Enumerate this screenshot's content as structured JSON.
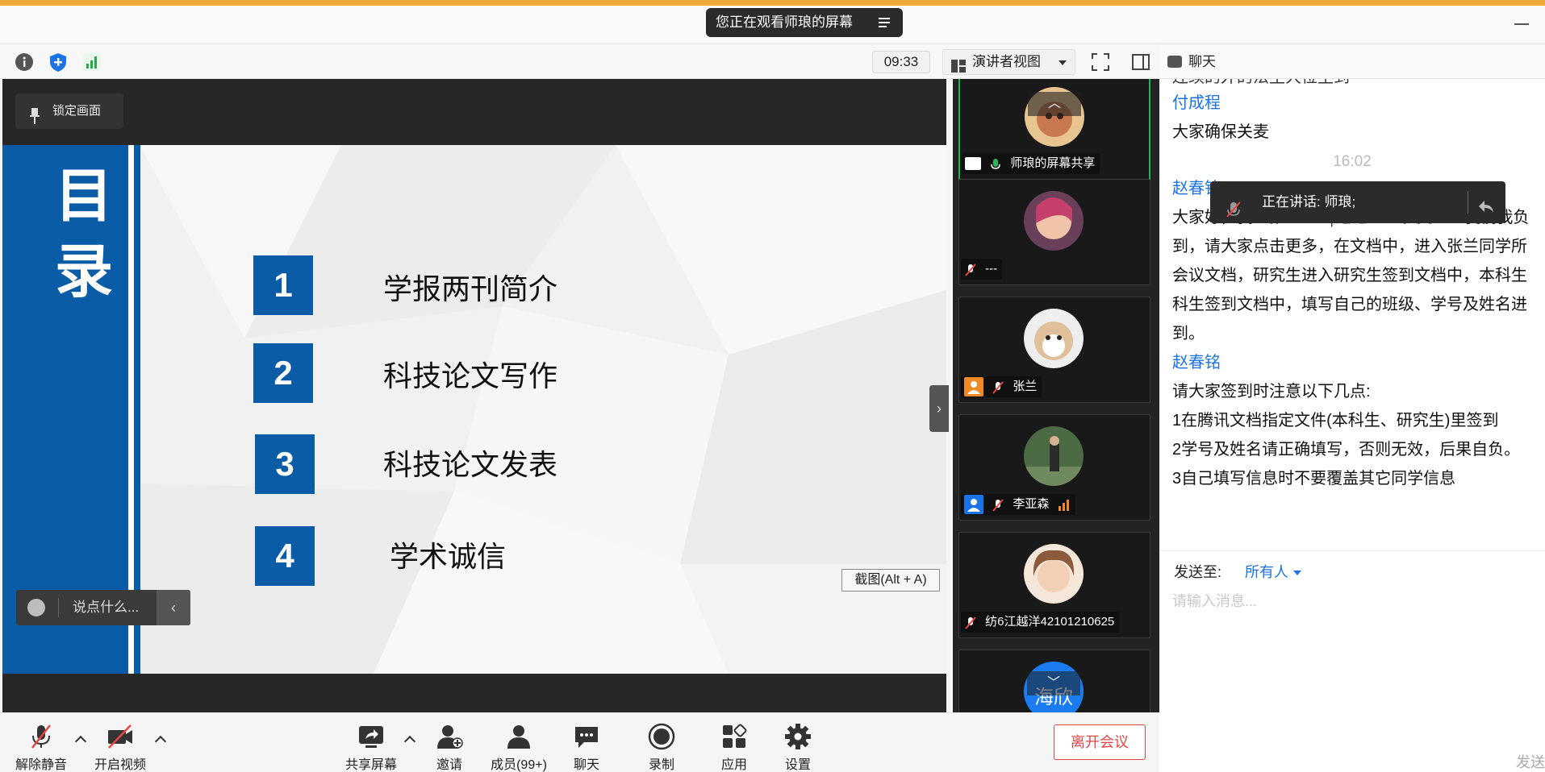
{
  "title_bar": {
    "viewing_text": "您正在观看师琅的屏幕"
  },
  "info_bar": {
    "time": "09:33",
    "view_mode": "演讲者视图"
  },
  "share": {
    "lock_label": "锁定画面",
    "say_placeholder": "说点什么...",
    "screenshot_tip": "截图(Alt + A)"
  },
  "slide": {
    "side_title_1": "目",
    "side_title_2": "录",
    "items": [
      {
        "num": "1",
        "text": "学报两刊简介"
      },
      {
        "num": "2",
        "text": "科技论文写作"
      },
      {
        "num": "3",
        "text": "科技论文发表"
      },
      {
        "num": "4",
        "text": "学术诚信"
      }
    ]
  },
  "participants": [
    {
      "name": "师琅的屏幕共享"
    },
    {
      "name": "---"
    },
    {
      "name": "张兰"
    },
    {
      "name": "李亚森"
    },
    {
      "name": "纺6江越洋42101210625"
    },
    {
      "name": "海欣"
    }
  ],
  "chat": {
    "title": "聊天",
    "partial_top": "连续的外的法生大位生到",
    "msg1_name": "付成程",
    "msg1_text": "大家确保关麦",
    "time": "16:02",
    "msg2_name": "赵春铭",
    "msg2_lines": [
      "大家好，我…第……ஷ通述……和负……我们我负",
      "到，请大家点击更多，在文档中，进入张兰同学所",
      "会议文档，研究生进入研究生签到文档中，本科生",
      "科生签到文档中，填写自己的班级、学号及姓名进",
      "到。"
    ],
    "msg3_name": "赵春铭",
    "msg3_lines": [
      "请大家签到时注意以下几点:",
      "1在腾讯文档指定文件(本科生、研究生)里签到",
      "2学号及姓名请正确填写，否则无效，后果自负。",
      "3自己填写信息时不要覆盖其它同学信息"
    ],
    "speaking": "正在讲话: 师琅;",
    "send_to_label": "发送至:",
    "send_to_value": "所有人",
    "input_placeholder": "请输入消息...",
    "send_button": "发送"
  },
  "toolbar": {
    "unmute": "解除静音",
    "start_video": "开启视频",
    "share_screen": "共享屏幕",
    "invite": "邀请",
    "members": "成员(99+)",
    "chat": "聊天",
    "record": "录制",
    "apps": "应用",
    "settings": "设置",
    "leave": "离开会议"
  },
  "colors": {
    "accent": "#0a5ca6",
    "link": "#1a73e8",
    "leave": "#e54545",
    "active_border": "#28b05b"
  }
}
